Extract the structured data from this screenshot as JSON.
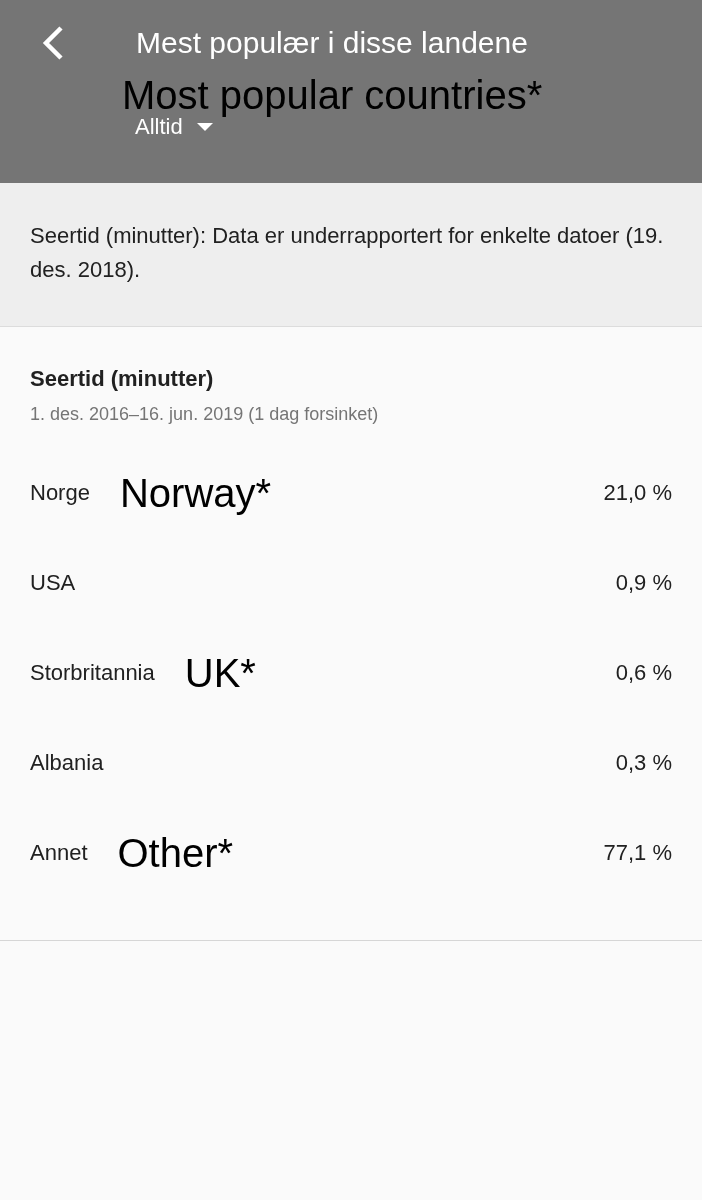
{
  "header": {
    "title": "Mest populær i disse landene",
    "annotation": "Most popular countries*",
    "period": "Alltid"
  },
  "notice": "Seertid (minutter): Data er underrapportert for enkelte datoer (19. des. 2018).",
  "card": {
    "title": "Seertid (minutter)",
    "subtitle": "1. des. 2016–16. jun. 2019 (1 dag forsinket)",
    "rows": [
      {
        "country": "Norge",
        "annotation": "Norway*",
        "share": "21,0 %"
      },
      {
        "country": "USA",
        "share": "0,9 %"
      },
      {
        "country": "Storbritannia",
        "annotation": "UK*",
        "share": "0,6 %"
      },
      {
        "country": "Albania",
        "share": "0,3 %"
      },
      {
        "country": "Annet",
        "annotation": "Other*",
        "share": "77,1 %"
      }
    ]
  }
}
